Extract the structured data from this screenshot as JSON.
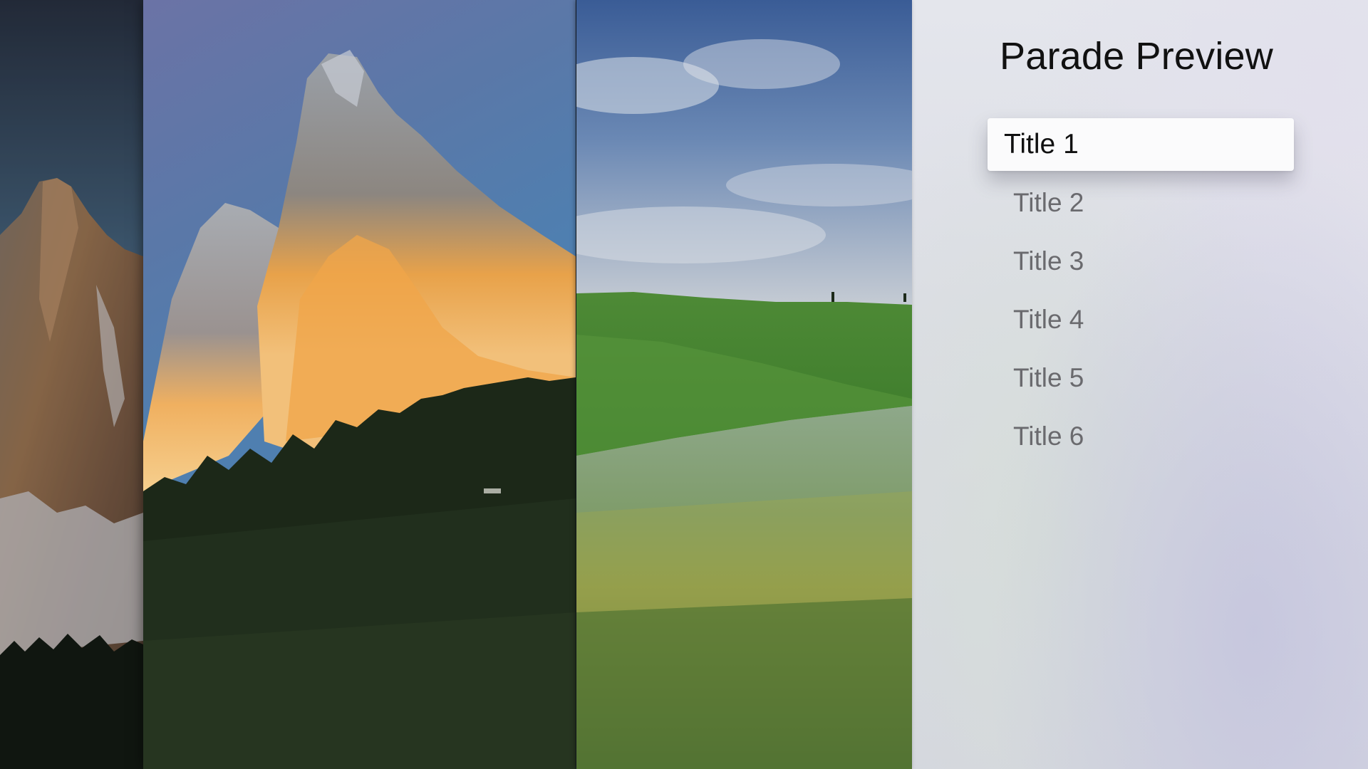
{
  "screen": {
    "title": "Parade Preview"
  },
  "menu": {
    "items": [
      {
        "label": "Title 1",
        "focused": true
      },
      {
        "label": "Title 2",
        "focused": false
      },
      {
        "label": "Title 3",
        "focused": false
      },
      {
        "label": "Title 4",
        "focused": false
      },
      {
        "label": "Title 5",
        "focused": false
      },
      {
        "label": "Title 6",
        "focused": false
      }
    ]
  },
  "parade": {
    "images": [
      {
        "subject": "snowy-mountain-peak"
      },
      {
        "subject": "sunlit-dolomite-cliff-over-pine-forest"
      },
      {
        "subject": "green-rolling-hills-and-meadow"
      }
    ]
  },
  "colors": {
    "focused_background": "#fbfbfc",
    "focused_text": "#111111",
    "unfocused_text": "#6a6a6e",
    "title_text": "#111111"
  }
}
